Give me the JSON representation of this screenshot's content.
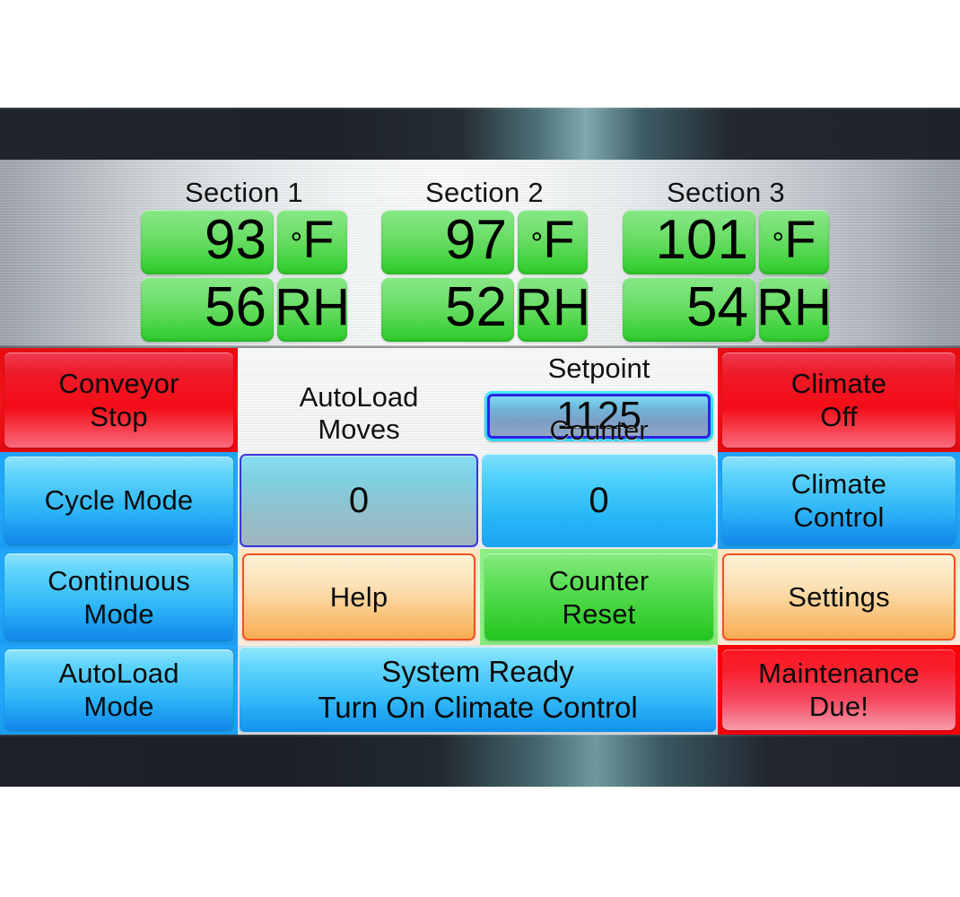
{
  "panel": {
    "sensor_sections": [
      {
        "name": "Section 1",
        "temp": "93",
        "temp_unit": "F",
        "humidity": "56",
        "humidity_unit": "RH"
      },
      {
        "name": "Section 2",
        "temp": "97",
        "temp_unit": "F",
        "humidity": "52",
        "humidity_unit": "RH"
      },
      {
        "name": "Section 3",
        "temp": "101",
        "temp_unit": "F",
        "humidity": "54",
        "humidity_unit": "RH"
      }
    ],
    "left_buttons": [
      {
        "label": "Conveyor\nStop",
        "line1": "Conveyor",
        "line2": "Stop"
      },
      {
        "label": "Cycle Mode",
        "line1": "Cycle Mode",
        "line2": ""
      },
      {
        "label": "Continuous\nMode",
        "line1": "Continuous",
        "line2": "Mode"
      },
      {
        "label": "AutoLoad\nMode",
        "line1": "AutoLoad",
        "line2": "Mode"
      }
    ],
    "right_buttons": [
      {
        "label": "Climate\nOff",
        "line1": "Climate",
        "line2": "Off"
      },
      {
        "label": "Climate\nControl",
        "line1": "Climate",
        "line2": "Control"
      },
      {
        "label": "Settings",
        "line1": "Settings",
        "line2": ""
      },
      {
        "label": "Maintenance\nDue!",
        "line1": "Maintenance",
        "line2": "Due!"
      }
    ],
    "setpoint": {
      "title": "Setpoint",
      "value": "1125"
    },
    "autoload_moves": {
      "title_line1": "AutoLoad",
      "title_line2": "Moves",
      "value": "0"
    },
    "counter": {
      "title": "Counter",
      "value": "0"
    },
    "help_button": {
      "label": "Help"
    },
    "counter_reset_button": {
      "line1": "Counter",
      "line2": "Reset"
    },
    "status_bar": {
      "line1": "System Ready",
      "line2": "Turn On Climate Control"
    },
    "colors": {
      "stop_red": "#f40d16",
      "mode_blue": "#2cb5f7",
      "action_orange": "#f9bf73",
      "reset_green": "#3ad134",
      "alert_red": "#f6475f",
      "led_green": "#3fd23b",
      "setpoint_border": "#2c23e8",
      "bezel_dark": "#20242b"
    }
  }
}
